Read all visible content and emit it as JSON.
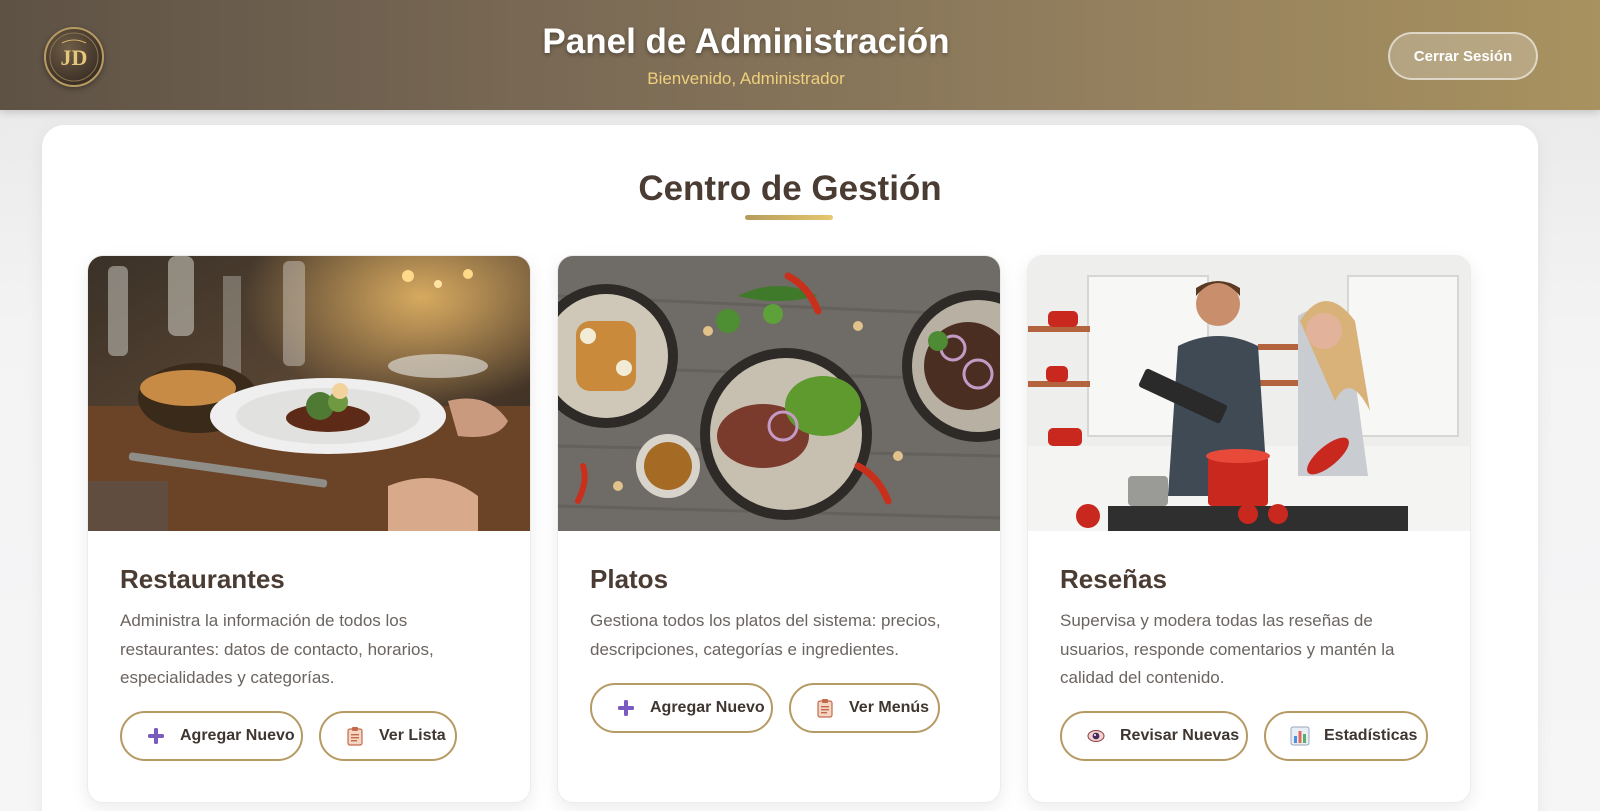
{
  "header": {
    "logo_text": "JD",
    "title": "Panel de Administración",
    "subtitle": "Bienvenido, Administrador",
    "logout_label": "Cerrar Sesión"
  },
  "main": {
    "section_title": "Centro de Gestión",
    "cards": [
      {
        "title": "Restaurantes",
        "image": "restaurant-dining-photo",
        "description": "Administra la información de todos los restaurantes: datos de contacto, horarios, especialidades y categorías.",
        "buttons": [
          {
            "label": "Agregar Nuevo",
            "icon": "plus-icon"
          },
          {
            "label": "Ver Lista",
            "icon": "clipboard-icon"
          }
        ]
      },
      {
        "title": "Platos",
        "image": "dishes-overhead-photo",
        "description": "Gestiona todos los platos del sistema: precios, descripciones, categorías e ingredientes.",
        "buttons": [
          {
            "label": "Agregar Nuevo",
            "icon": "plus-icon"
          },
          {
            "label": "Ver Menús",
            "icon": "clipboard-icon"
          }
        ]
      },
      {
        "title": "Reseñas",
        "image": "couple-cooking-photo",
        "description": "Supervisa y modera todas las reseñas de usuarios, responde comentarios y mantén la calidad del contenido.",
        "buttons": [
          {
            "label": "Revisar Nuevas",
            "icon": "eye-icon"
          },
          {
            "label": "Estadísticas",
            "icon": "bar-chart-icon"
          }
        ]
      }
    ]
  },
  "colors": {
    "header_start": "#5e5245",
    "header_end": "#a8925f",
    "accent_gold": "#b69a63",
    "title_brown": "#4a3c33",
    "subtitle_gold": "#f0cf7c"
  }
}
